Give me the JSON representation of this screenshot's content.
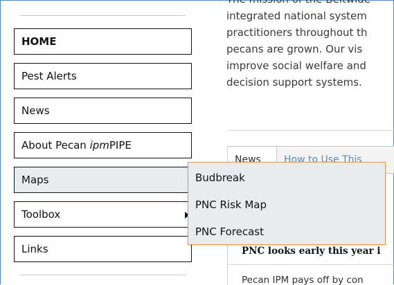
{
  "nav": {
    "items": [
      {
        "label": "HOME"
      },
      {
        "label": "Pest Alerts"
      },
      {
        "label": "News"
      },
      {
        "label_prefix": "About Pecan ",
        "label_italic": "ipm",
        "label_suffix": "PIPE"
      },
      {
        "label": "Maps"
      },
      {
        "label": "Toolbox"
      },
      {
        "label": "Links"
      }
    ]
  },
  "maps_menu": {
    "items": [
      "Budbreak",
      "PNC Risk Map",
      "PNC Forecast"
    ]
  },
  "content": {
    "mission_lines": [
      "The mission of the Beltwide",
      "integrated national system",
      "practitioners throughout th",
      "pecans are grown. Our vis",
      "improve social welfare and",
      "decision support systems."
    ],
    "tabs": [
      "News",
      "How to Use This"
    ],
    "article_title": "PNC looks early this year i",
    "article_snippet": "Pecan IPM pays off by con"
  },
  "colors": {
    "frame_border": "#4b88c8",
    "dropdown_border": "#e39a4b",
    "dropdown_bg": "#e8ecef"
  }
}
